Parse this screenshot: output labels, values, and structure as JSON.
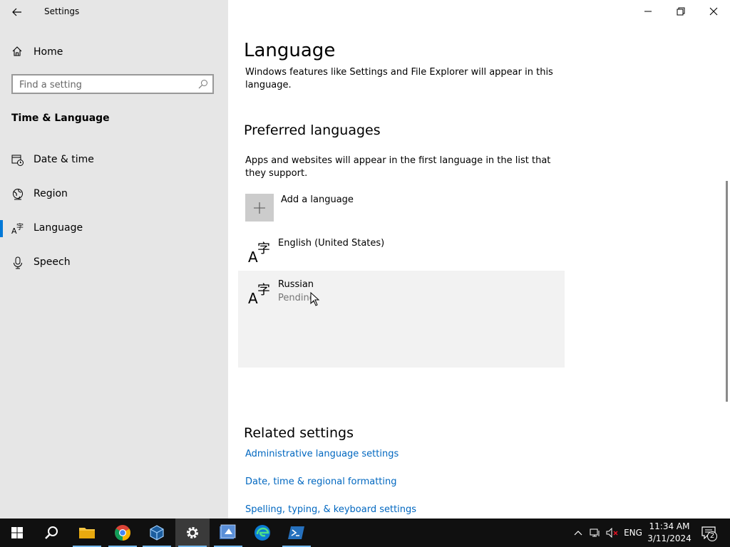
{
  "window": {
    "title": "Settings",
    "minimize_label": "Minimize",
    "maximize_label": "Restore",
    "close_label": "Close"
  },
  "sidebar": {
    "home_label": "Home",
    "search_placeholder": "Find a setting",
    "section_title": "Time & Language",
    "items": [
      {
        "label": "Date & time",
        "icon": "calendar-clock-icon"
      },
      {
        "label": "Region",
        "icon": "globe-icon"
      },
      {
        "label": "Language",
        "icon": "language-icon",
        "active": true
      },
      {
        "label": "Speech",
        "icon": "microphone-icon"
      }
    ]
  },
  "main": {
    "title": "Language",
    "display_language_desc": "Windows features like Settings and File Explorer will appear in this language.",
    "preferred_heading": "Preferred languages",
    "preferred_desc": "Apps and websites will appear in the first language in the list that they support.",
    "add_language_label": "Add a language",
    "languages": [
      {
        "name": "English (United States)",
        "status": ""
      },
      {
        "name": "Russian",
        "status": "Pending"
      }
    ],
    "related_heading": "Related settings",
    "related_links": [
      "Administrative language settings",
      "Date, time & regional formatting",
      "Spelling, typing, & keyboard settings"
    ]
  },
  "taskbar": {
    "apps": [
      "start",
      "search",
      "file-explorer",
      "chrome",
      "virtualbox",
      "settings",
      "app",
      "edge",
      "powershell"
    ],
    "active_app": "settings",
    "language_indicator": "ENG",
    "time": "11:34 AM",
    "date": "3/11/2024",
    "notification_count": "2"
  },
  "colors": {
    "sidebar_bg": "#e6e6e6",
    "accent": "#0078d7",
    "link": "#0067c0",
    "taskbar_bg": "#101010"
  }
}
